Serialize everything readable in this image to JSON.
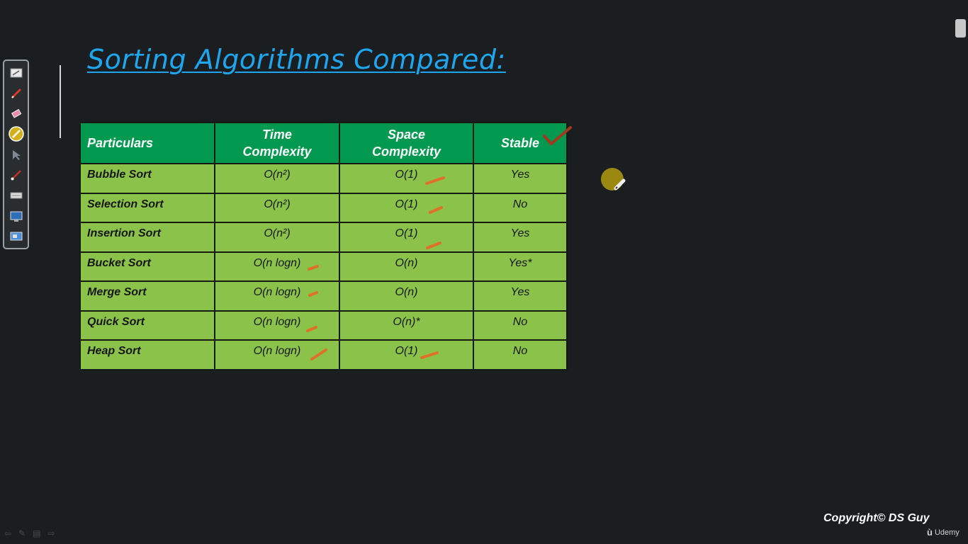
{
  "title": "Sorting Algorithms Compared:",
  "table": {
    "headers": {
      "particulars": "Particulars",
      "time_line1": "Time",
      "time_line2": "Complexity",
      "space_line1": "Space",
      "space_line2": "Complexity",
      "stable": "Stable"
    },
    "rows": [
      {
        "name": "Bubble Sort",
        "time": "O(n²)",
        "space": "O(1)",
        "stable": "Yes"
      },
      {
        "name": "Selection Sort",
        "time": "O(n²)",
        "space": "O(1)",
        "stable": "No"
      },
      {
        "name": "Insertion Sort",
        "time": "O(n²)",
        "space": "O(1)",
        "stable": "Yes"
      },
      {
        "name": "Bucket Sort",
        "time": "O(n logn)",
        "space": "O(n)",
        "stable": "Yes*"
      },
      {
        "name": "Merge Sort",
        "time": "O(n logn)",
        "space": "O(n)",
        "stable": "Yes"
      },
      {
        "name": "Quick Sort",
        "time": "O(n logn)",
        "space": "O(n)*",
        "stable": "No"
      },
      {
        "name": "Heap Sort",
        "time": "O(n logn)",
        "space": "O(1)",
        "stable": "No"
      }
    ]
  },
  "footer": {
    "copyright": "Copyright© DS Guy",
    "brand": "Udemy"
  },
  "toolbar": {
    "icons": [
      "slide-icon",
      "pen-icon",
      "eraser-icon",
      "highlighter-icon",
      "pointer-icon",
      "brush-icon",
      "keyboard-icon",
      "screen-icon",
      "monitor-icon"
    ]
  },
  "colors": {
    "background": "#1b1e20",
    "title": "#1ea6ef",
    "header_fill": "#00994f",
    "cell_fill": "#8bc34a",
    "annotation_orange": "#e07028",
    "annotation_red": "#a3381e"
  }
}
